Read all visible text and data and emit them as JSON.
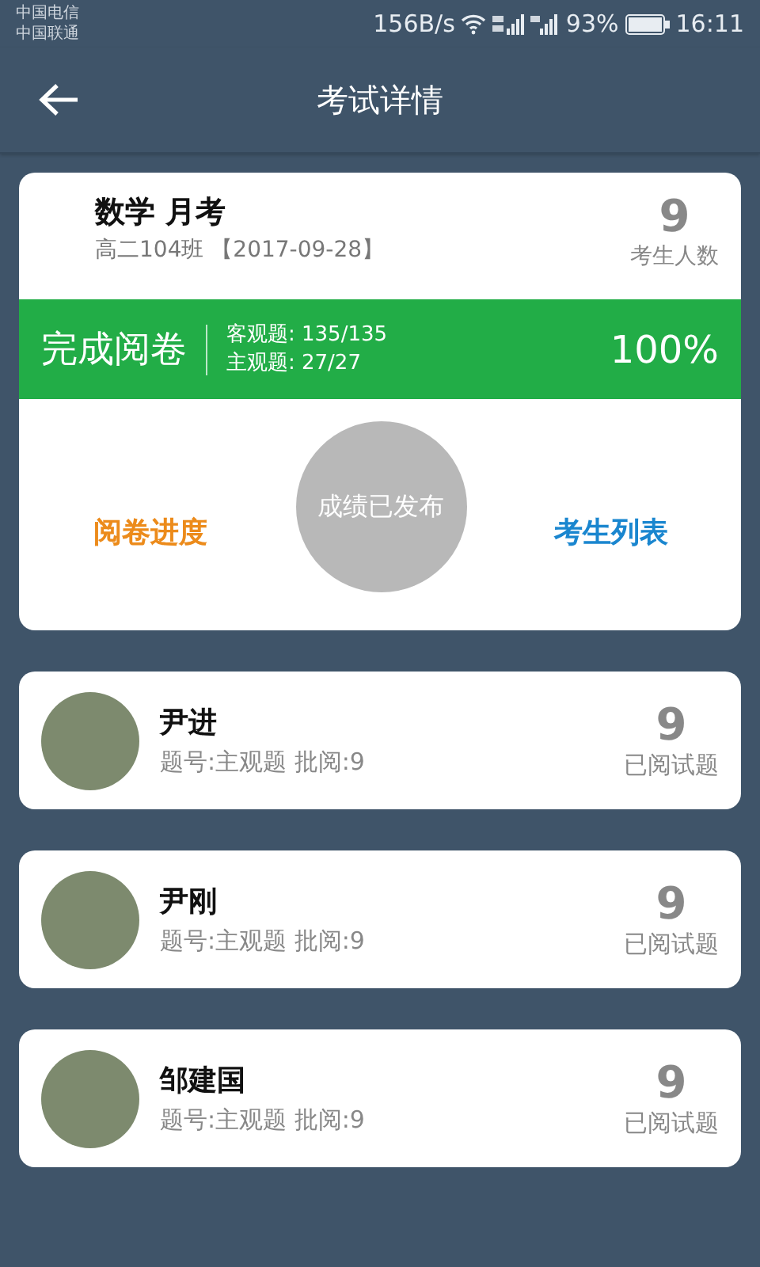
{
  "status_bar": {
    "carriers": [
      "中国电信",
      "中国联通"
    ],
    "net_speed": "156B/s",
    "battery": "93%",
    "time": "16:11"
  },
  "app_bar": {
    "title": "考试详情"
  },
  "exam": {
    "title": "数学 月考",
    "subtitle": "高二104班 【2017-09-28】",
    "count": "9",
    "count_label": "考生人数",
    "status": "完成阅卷",
    "objective": "客观题: 135/135",
    "subjective": "主观题: 27/27",
    "percent": "100%",
    "progress_link": "阅卷进度",
    "published": "成绩已发布",
    "students_link": "考生列表"
  },
  "students": [
    {
      "name": "尹进",
      "detail": "题号:主观题 批阅:9",
      "count": "9",
      "count_label": "已阅试题"
    },
    {
      "name": "尹刚",
      "detail": "题号:主观题 批阅:9",
      "count": "9",
      "count_label": "已阅试题"
    },
    {
      "name": "邹建国",
      "detail": "题号:主观题 批阅:9",
      "count": "9",
      "count_label": "已阅试题"
    }
  ]
}
